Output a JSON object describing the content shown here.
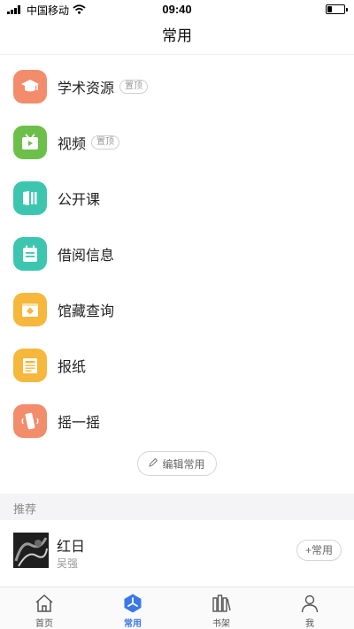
{
  "status_bar": {
    "carrier": "中国移动",
    "time": "09:40",
    "battery_level": 0.3
  },
  "nav": {
    "title": "常用"
  },
  "pin_label": "置顶",
  "menu": [
    {
      "label": "学术资源",
      "icon": "graduation-cap-icon",
      "color": "#F28C6B",
      "pinned": true
    },
    {
      "label": "视频",
      "icon": "video-icon",
      "color": "#6CC04A",
      "pinned": true
    },
    {
      "label": "公开课",
      "icon": "open-course-icon",
      "color": "#3CC6B0",
      "pinned": false
    },
    {
      "label": "借阅信息",
      "icon": "calendar-icon",
      "color": "#3CC6B0",
      "pinned": false
    },
    {
      "label": "馆藏查询",
      "icon": "collection-search-icon",
      "color": "#F5B83D",
      "pinned": false
    },
    {
      "label": "报纸",
      "icon": "newspaper-icon",
      "color": "#F5B83D",
      "pinned": false
    },
    {
      "label": "摇一摇",
      "icon": "shake-phone-icon",
      "color": "#F28C6B",
      "pinned": false
    }
  ],
  "edit_button": "编辑常用",
  "section": {
    "title": "推荐"
  },
  "recommend": [
    {
      "title": "红日",
      "author": "吴强",
      "add_label": "+常用"
    }
  ],
  "tabs": [
    {
      "label": "首页",
      "icon": "home-icon",
      "active": false
    },
    {
      "label": "常用",
      "icon": "common-icon",
      "active": true
    },
    {
      "label": "书架",
      "icon": "bookshelf-icon",
      "active": false
    },
    {
      "label": "我",
      "icon": "profile-icon",
      "active": false
    }
  ],
  "colors": {
    "accent": "#3B78E7"
  }
}
